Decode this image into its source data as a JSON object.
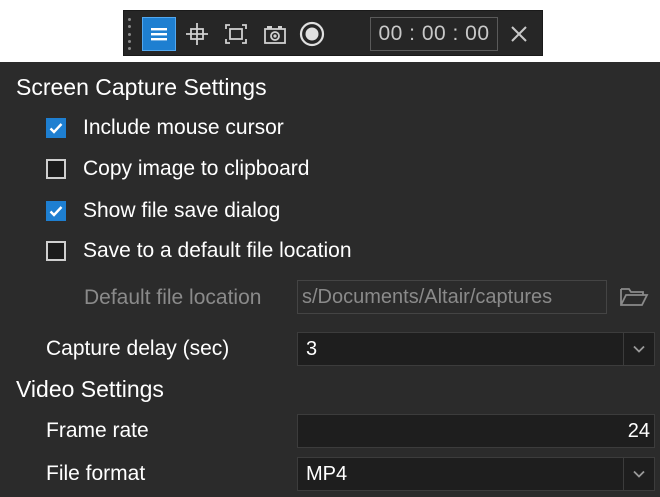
{
  "toolbar": {
    "icons": [
      "menu-icon",
      "crosshair-icon",
      "region-select-icon",
      "camera-icon",
      "record-icon",
      "close-icon"
    ],
    "timer": "00 : 00 : 00",
    "accent": "#1e7fd1"
  },
  "screen_capture": {
    "title": "Screen Capture Settings",
    "include_mouse_cursor": {
      "label": "Include mouse cursor",
      "checked": true
    },
    "copy_to_clipboard": {
      "label": "Copy image to clipboard",
      "checked": false
    },
    "show_file_save_dialog": {
      "label": "Show file save dialog",
      "checked": true
    },
    "save_to_default_location": {
      "label": "Save to a default file location",
      "checked": false
    },
    "default_file_location": {
      "label": "Default file location",
      "value": "s/Documents/Altair/captures"
    },
    "capture_delay": {
      "label": "Capture delay (sec)",
      "value": "3"
    }
  },
  "video": {
    "title": "Video Settings",
    "frame_rate": {
      "label": "Frame rate",
      "value": "24"
    },
    "file_format": {
      "label": "File format",
      "value": "MP4"
    }
  },
  "colors": {
    "panel_bg": "#2b2b2b",
    "field_bg": "#1e1e1e",
    "checkbox_on": "#1e7fd1"
  }
}
